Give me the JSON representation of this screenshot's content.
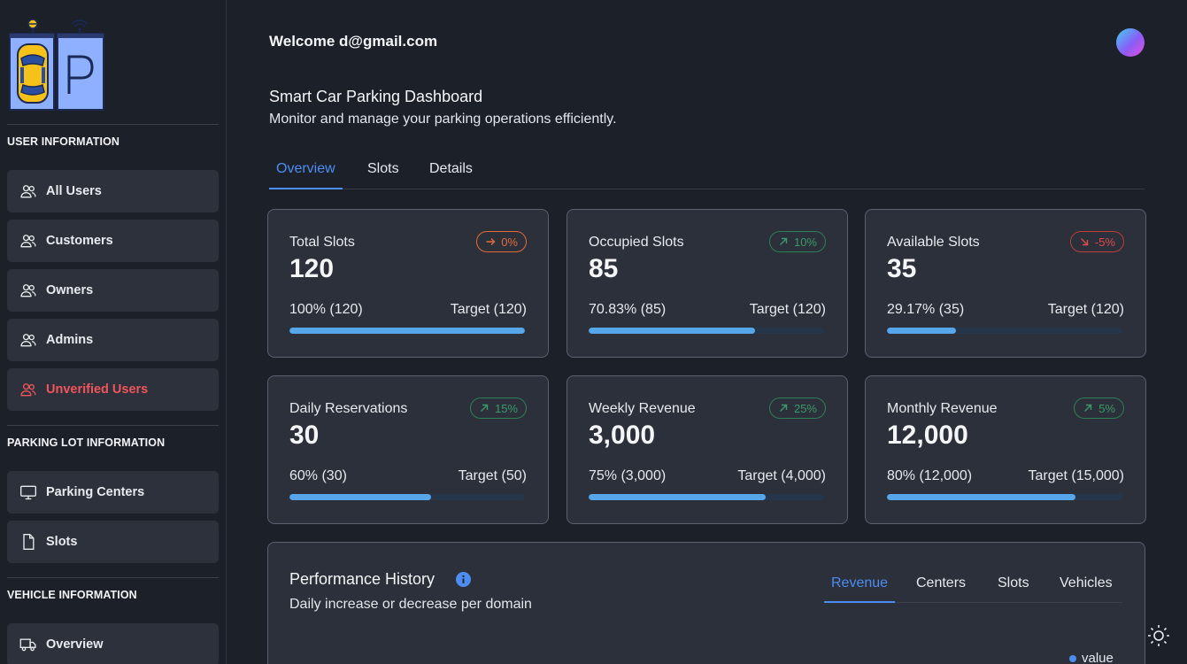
{
  "sidebar": {
    "sections": [
      {
        "title": "USER INFORMATION"
      },
      {
        "title": "PARKING LOT INFORMATION"
      },
      {
        "title": "VEHICLE INFORMATION"
      }
    ],
    "items": [
      {
        "label": "All Users",
        "icon": "users-icon"
      },
      {
        "label": "Customers",
        "icon": "users-icon"
      },
      {
        "label": "Owners",
        "icon": "users-icon"
      },
      {
        "label": "Admins",
        "icon": "users-icon"
      },
      {
        "label": "Unverified Users",
        "icon": "users-icon",
        "color": "#f0555b"
      },
      {
        "label": "Parking Centers",
        "icon": "monitor-icon"
      },
      {
        "label": "Slots",
        "icon": "file-icon"
      },
      {
        "label": "Overview",
        "icon": "truck-icon"
      }
    ]
  },
  "header": {
    "welcome": "Welcome d@gmail.com",
    "title": "Smart Car Parking Dashboard",
    "subtitle": "Monitor and manage your parking operations efficiently."
  },
  "tabs": [
    {
      "label": "Overview",
      "active": true
    },
    {
      "label": "Slots",
      "active": false
    },
    {
      "label": "Details",
      "active": false
    }
  ],
  "cards": [
    {
      "label": "Total Slots",
      "value": "120",
      "badge": "0%",
      "trend": "neutral",
      "pct_text": "100% (120)",
      "target_text": "Target (120)",
      "progress": 1.0
    },
    {
      "label": "Occupied Slots",
      "value": "85",
      "badge": "10%",
      "trend": "up",
      "pct_text": "70.83% (85)",
      "target_text": "Target (120)",
      "progress": 0.7083
    },
    {
      "label": "Available Slots",
      "value": "35",
      "badge": "-5%",
      "trend": "down",
      "pct_text": "29.17% (35)",
      "target_text": "Target (120)",
      "progress": 0.2917
    },
    {
      "label": "Daily Reservations",
      "value": "30",
      "badge": "15%",
      "trend": "up",
      "pct_text": "60% (30)",
      "target_text": "Target (50)",
      "progress": 0.6
    },
    {
      "label": "Weekly Revenue",
      "value": "3,000",
      "badge": "25%",
      "trend": "up",
      "pct_text": "75% (3,000)",
      "target_text": "Target (4,000)",
      "progress": 0.75
    },
    {
      "label": "Monthly Revenue",
      "value": "12,000",
      "badge": "5%",
      "trend": "up",
      "pct_text": "80% (12,000)",
      "target_text": "Target (15,000)",
      "progress": 0.8
    }
  ],
  "performance": {
    "title": "Performance History",
    "subtitle": "Daily increase or decrease per domain",
    "tabs": [
      {
        "label": "Revenue",
        "active": true
      },
      {
        "label": "Centers",
        "active": false
      },
      {
        "label": "Slots",
        "active": false
      },
      {
        "label": "Vehicles",
        "active": false
      }
    ],
    "legend": "value"
  },
  "colors": {
    "accent": "#4d8df2",
    "progress": "#58a6ea",
    "danger": "#f0555b",
    "up": "#3c9a6a",
    "neutral": "#e46a3a"
  }
}
